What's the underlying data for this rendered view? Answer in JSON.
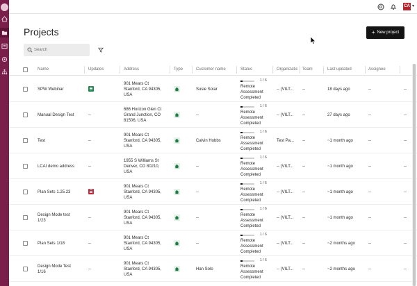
{
  "app": {
    "page_title": "Projects",
    "new_project_label": "New project",
    "search_placeholder": "Search",
    "avatar_initials": "CA"
  },
  "colors": {
    "sidebar": "#7a1f49",
    "primary_button": "#141414",
    "updates_green": "#1f8a4c",
    "updates_red": "#c92a3a",
    "type_badge_bg": "#e5f2ea",
    "type_icon": "#1f7a45"
  },
  "sidebar": {
    "items": [
      {
        "icon": "logo-icon"
      },
      {
        "icon": "home-icon"
      },
      {
        "icon": "folder-icon",
        "active": true
      },
      {
        "icon": "list-icon"
      },
      {
        "icon": "settings-icon"
      },
      {
        "icon": "org-chart-icon"
      }
    ]
  },
  "topbar": {
    "icons": [
      "help-icon",
      "bell-icon",
      "avatar",
      "chevron-down-icon"
    ]
  },
  "columns": [
    "Name",
    "Updates",
    "Address",
    "Type",
    "Customer name",
    "Status",
    "Organizatic",
    "Team",
    "Last updated",
    "Assignee"
  ],
  "rows": [
    {
      "name_lines": [
        "SPW Webinar"
      ],
      "updates": "green",
      "address_lines": [
        "901 Mears Ct",
        "Stanford, CA 94305,",
        "USA"
      ],
      "customer": "Susie Solar",
      "progress": "1 / 6",
      "progress_fraction": 0.167,
      "status_lines": [
        "Remote",
        "Assessment",
        "Completed"
      ],
      "organization": "-- (VILT...",
      "team": "--",
      "last_updated": "18 days ago",
      "assignee": "--",
      "extra": "--"
    },
    {
      "name_lines": [
        "Manual Design Test"
      ],
      "updates": "--",
      "address_lines": [
        "686 Horizon Glen Ct",
        "Grand Junction, CO",
        "81506, USA"
      ],
      "customer": "--",
      "progress": "1 / 6",
      "progress_fraction": 0.167,
      "status_lines": [
        "Remote",
        "Assessment",
        "Completed"
      ],
      "organization": "-- (VILT...",
      "team": "--",
      "last_updated": "27 days ago",
      "assignee": "--",
      "extra": "--"
    },
    {
      "name_lines": [
        "Test"
      ],
      "updates": "--",
      "address_lines": [
        "901 Mears Ct",
        "Stanford, CA 94305,",
        "USA"
      ],
      "customer": "Calvin Hobbs",
      "progress": "1 / 6",
      "progress_fraction": 0.167,
      "status_lines": [
        "Remote",
        "Assessment",
        "Completed"
      ],
      "organization": "Test Pa...",
      "team": "--",
      "last_updated": "~1 month ago",
      "assignee": "--",
      "extra": "--"
    },
    {
      "name_lines": [
        "LCAI demo address"
      ],
      "updates": "--",
      "address_lines": [
        "1955 S Williams St",
        "Denver, CO 80210,",
        "USA"
      ],
      "customer": "--",
      "progress": "1 / 6",
      "progress_fraction": 0.167,
      "status_lines": [
        "Remote",
        "Assessment",
        "Completed"
      ],
      "organization": "-- (VILT...",
      "team": "--",
      "last_updated": "~1 month ago",
      "assignee": "--",
      "extra": "--"
    },
    {
      "name_lines": [
        "Plan Sets 1.25.23"
      ],
      "updates": "red",
      "address_lines": [
        "901 Mears Ct",
        "Stanford, CA 94305,",
        "USA"
      ],
      "customer": "--",
      "progress": "1 / 6",
      "progress_fraction": 0.167,
      "status_lines": [
        "Remote",
        "Assessment",
        "Completed"
      ],
      "organization": "-- (VILT...",
      "team": "--",
      "last_updated": "~1 month ago",
      "assignee": "--",
      "extra": "--"
    },
    {
      "name_lines": [
        "Design Mode test",
        "1/23"
      ],
      "updates": "--",
      "address_lines": [
        "901 Mears Ct",
        "Stanford, CA 94305,",
        "USA"
      ],
      "customer": "--",
      "progress": "1 / 6",
      "progress_fraction": 0.167,
      "status_lines": [
        "Remote",
        "Assessment",
        "Completed"
      ],
      "organization": "-- (VILT...",
      "team": "--",
      "last_updated": "~1 month ago",
      "assignee": "--",
      "extra": "--"
    },
    {
      "name_lines": [
        "Plan Sets 1/18"
      ],
      "updates": "--",
      "address_lines": [
        "901 Mears Ct",
        "Stanford, CA 94305,",
        "USA"
      ],
      "customer": "--",
      "progress": "1 / 6",
      "progress_fraction": 0.167,
      "status_lines": [
        "Remote",
        "Assessment",
        "Completed"
      ],
      "organization": "-- (VILT...",
      "team": "--",
      "last_updated": "~2 months ago",
      "assignee": "--",
      "extra": "--"
    },
    {
      "name_lines": [
        "Design Mode Test",
        "1/16"
      ],
      "updates": "--",
      "address_lines": [
        "901 Mears Ct",
        "Stanford, CA 94305,",
        "USA"
      ],
      "customer": "Han Solo",
      "progress": "1 / 6",
      "progress_fraction": 0.167,
      "status_lines": [
        "Remote",
        "Assessment",
        "Completed"
      ],
      "organization": "-- (VILT...",
      "team": "--",
      "last_updated": "~2 months ago",
      "assignee": "--",
      "extra": "--"
    }
  ]
}
